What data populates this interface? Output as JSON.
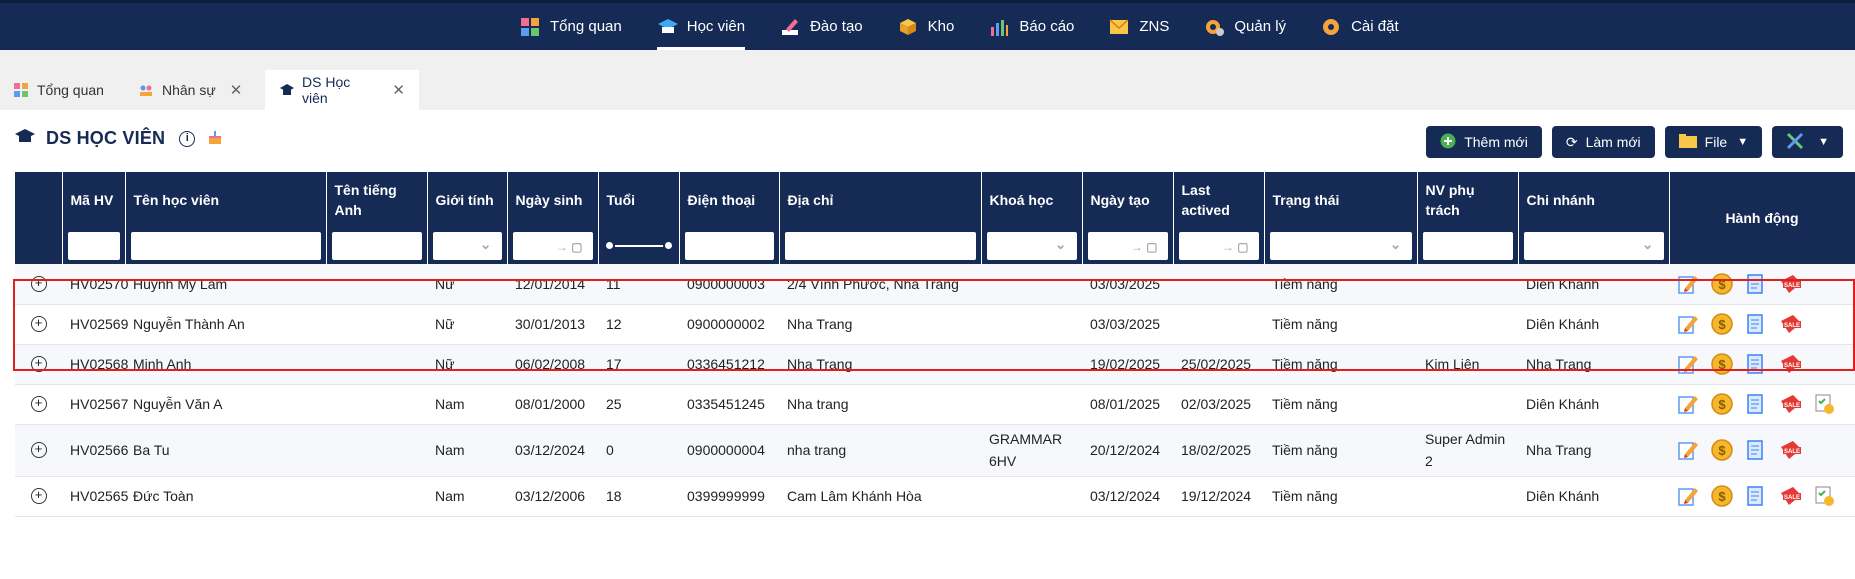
{
  "topnav": {
    "items": [
      {
        "label": "Tổng quan",
        "icon": "dashboard-icon"
      },
      {
        "label": "Học viên",
        "icon": "graduation-cap-icon",
        "active": true
      },
      {
        "label": "Đào tạo",
        "icon": "pen-icon"
      },
      {
        "label": "Kho",
        "icon": "box-icon"
      },
      {
        "label": "Báo cáo",
        "icon": "chart-icon"
      },
      {
        "label": "ZNS",
        "icon": "mail-icon"
      },
      {
        "label": "Quản lý",
        "icon": "gear-user-icon"
      },
      {
        "label": "Cài đặt",
        "icon": "gear-icon"
      }
    ]
  },
  "tabs": [
    {
      "label": "Tổng quan"
    },
    {
      "label": "Nhân sự"
    },
    {
      "label": "DS Học viên"
    }
  ],
  "page": {
    "title": "DS HỌC VIÊN"
  },
  "buttons": {
    "add": "Thêm mới",
    "refresh": "Làm mới",
    "file": "File"
  },
  "table": {
    "headers": {
      "code": "Mã HV",
      "name": "Tên học viên",
      "en_name": "Tên tiếng Anh",
      "gender": "Giới tính",
      "dob": "Ngày sinh",
      "age": "Tuổi",
      "phone": "Điện thoại",
      "address": "Địa chỉ",
      "course": "Khoá học",
      "created": "Ngày tạo",
      "last_active": "Last actived",
      "status": "Trạng thái",
      "staff": "NV phụ trách",
      "branch": "Chi nhánh",
      "actions": "Hành động"
    },
    "rows": [
      {
        "code": "HV02570",
        "name": "Huỳnh Mỹ Lam",
        "en_name": "",
        "gender": "Nữ",
        "dob": "12/01/2014",
        "age": "11",
        "phone": "0900000003",
        "address": "2/4 Vĩnh Phước, Nha Trang",
        "course": "",
        "created": "03/03/2025",
        "last_active": "",
        "status": "Tiềm năng",
        "staff": "",
        "branch": "Diên Khánh"
      },
      {
        "code": "HV02569",
        "name": "Nguyễn Thành An",
        "en_name": "",
        "gender": "Nữ",
        "dob": "30/01/2013",
        "age": "12",
        "phone": "0900000002",
        "address": "Nha Trang",
        "course": "",
        "created": "03/03/2025",
        "last_active": "",
        "status": "Tiềm năng",
        "staff": "",
        "branch": "Diên Khánh"
      },
      {
        "code": "HV02568",
        "name": "Minh Anh",
        "en_name": "",
        "gender": "Nữ",
        "dob": "06/02/2008",
        "age": "17",
        "phone": "0336451212",
        "address": "Nha Trang",
        "course": "",
        "created": "19/02/2025",
        "last_active": "25/02/2025",
        "status": "Tiềm năng",
        "staff": "Kim Liên",
        "branch": "Nha Trang"
      },
      {
        "code": "HV02567",
        "name": "Nguyễn Văn A",
        "en_name": "",
        "gender": "Nam",
        "dob": "08/01/2000",
        "age": "25",
        "phone": "0335451245",
        "address": "Nha trang",
        "course": "",
        "created": "08/01/2025",
        "last_active": "02/03/2025",
        "status": "Tiềm năng",
        "staff": "",
        "branch": "Diên Khánh"
      },
      {
        "code": "HV02566",
        "name": "Ba Tu",
        "en_name": "",
        "gender": "Nam",
        "dob": "03/12/2024",
        "age": "0",
        "phone": "0900000004",
        "address": "nha trang",
        "course": "GRAMMAR 6HV",
        "created": "20/12/2024",
        "last_active": "18/02/2025",
        "status": "Tiềm năng",
        "staff": "Super Admin 2",
        "branch": "Nha Trang"
      },
      {
        "code": "HV02565",
        "name": "Đức Toàn",
        "en_name": "",
        "gender": "Nam",
        "dob": "03/12/2006",
        "age": "18",
        "phone": "0399999999",
        "address": "Cam Lâm Khánh Hòa",
        "course": "",
        "created": "03/12/2024",
        "last_active": "19/12/2024",
        "status": "Tiềm năng",
        "staff": "",
        "branch": "Diên Khánh"
      }
    ]
  },
  "colors": {
    "navy": "#152a55",
    "highlight": "#e01f1f"
  }
}
